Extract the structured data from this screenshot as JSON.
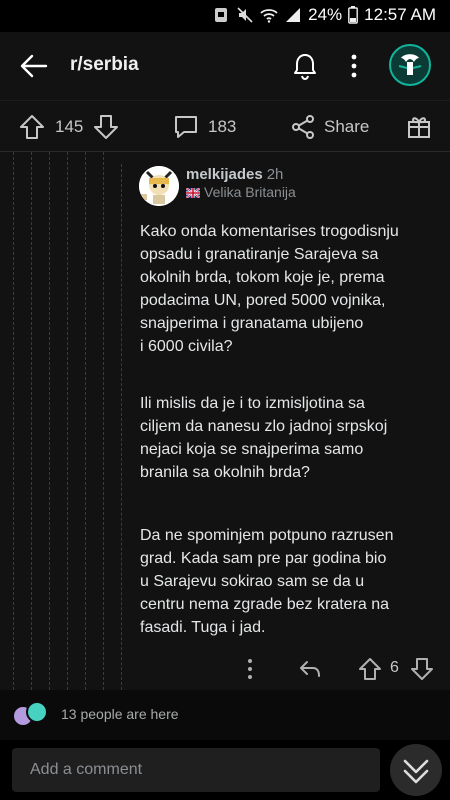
{
  "status_bar": {
    "battery": "24%",
    "time": "12:57 AM"
  },
  "app_bar": {
    "subreddit": "r/serbia",
    "back_icon": "arrow-left-icon",
    "bell_icon": "bell-icon",
    "menu_icon": "more-vertical-icon",
    "avatar_color": "#11b59b"
  },
  "post_actions": {
    "score": "145",
    "comments": "183",
    "share_label": "Share"
  },
  "comment": {
    "username": "melkijades",
    "age": "2h",
    "flair": "Velika Britanija",
    "paragraphs": [
      "Kako onda komentarises trogodisnju\nopsadu i granatiranje Sarajeva sa\nokolnih brda, tokom koje je, prema\npodacima UN, pored 5000 vojnika,\nsnajperima i granatama ubijeno\ni 6000 civila?",
      "Ili mislis da je i to izmisljotina sa\nciljem da nanesu zlo jadnoj srpskoj\nnejaci koja se snajperima samo\nbranila sa okolnih brda?",
      "Da ne spominjem potpuno razrusen\ngrad. Kada sam pre par godina bio\nu Sarajevu sokirao sam se da u\ncentru nema zgrade bez kratera na\nfasadi. Tuga i jad."
    ],
    "score": "6"
  },
  "presence": {
    "text": "13 people are here"
  },
  "composer": {
    "placeholder": "Add a comment"
  },
  "colors": {
    "background": "#121212",
    "accent": "#11b59b",
    "text": "#e4e6e8"
  }
}
